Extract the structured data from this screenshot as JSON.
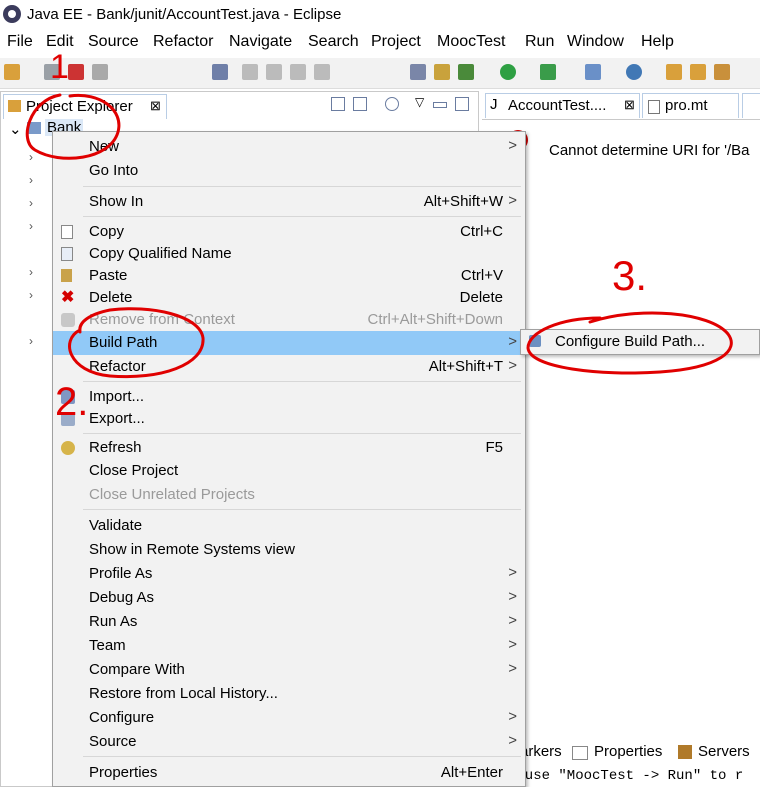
{
  "window": {
    "title": "Java EE - Bank/junit/AccountTest.java - Eclipse"
  },
  "menubar": [
    "File",
    "Edit",
    "Source",
    "Refactor",
    "Navigate",
    "Search",
    "Project",
    "MoocTest",
    "Run",
    "Window",
    "Help"
  ],
  "explorer": {
    "tab_label": "Project Explorer",
    "close": "⊠",
    "project": "Bank"
  },
  "editor": {
    "tabs": [
      {
        "label": "AccountTest....",
        "close": "⊠"
      },
      {
        "label": "pro.mt"
      }
    ],
    "error_text": "Cannot determine URI for '/Ba"
  },
  "bottom": {
    "tabs": [
      "arkers",
      "Properties",
      "Servers"
    ],
    "console_line": "e use \"MoocTest -> Run\" to r"
  },
  "context_menu": {
    "items": [
      {
        "label": "New",
        "arrow": ">"
      },
      {
        "label": "Go Into"
      },
      {
        "label": "Show In",
        "shortcut": "Alt+Shift+W",
        "arrow": ">"
      },
      {
        "label": "Copy",
        "shortcut": "Ctrl+C"
      },
      {
        "label": "Copy Qualified Name"
      },
      {
        "label": "Paste",
        "shortcut": "Ctrl+V"
      },
      {
        "label": "Delete",
        "shortcut": "Delete"
      },
      {
        "label": "Remove from Context",
        "shortcut": "Ctrl+Alt+Shift+Down"
      },
      {
        "label": "Build Path",
        "arrow": ">"
      },
      {
        "label": "Refactor",
        "shortcut": "Alt+Shift+T",
        "arrow": ">"
      },
      {
        "label": "Import..."
      },
      {
        "label": "Export..."
      },
      {
        "label": "Refresh",
        "shortcut": "F5"
      },
      {
        "label": "Close Project"
      },
      {
        "label": "Close Unrelated Projects"
      },
      {
        "label": "Validate"
      },
      {
        "label": "Show in Remote Systems view"
      },
      {
        "label": "Profile As",
        "arrow": ">"
      },
      {
        "label": "Debug As",
        "arrow": ">"
      },
      {
        "label": "Run As",
        "arrow": ">"
      },
      {
        "label": "Team",
        "arrow": ">"
      },
      {
        "label": "Compare With",
        "arrow": ">"
      },
      {
        "label": "Restore from Local History..."
      },
      {
        "label": "Configure",
        "arrow": ">"
      },
      {
        "label": "Source",
        "arrow": ">"
      },
      {
        "label": "Properties",
        "shortcut": "Alt+Enter"
      }
    ]
  },
  "submenu": {
    "label": "Configure Build Path..."
  },
  "annotations": [
    "1",
    "2.",
    "3."
  ],
  "colors": {
    "highlight": "#91c9f7",
    "annotation": "#e00000",
    "error": "#cc0000"
  }
}
